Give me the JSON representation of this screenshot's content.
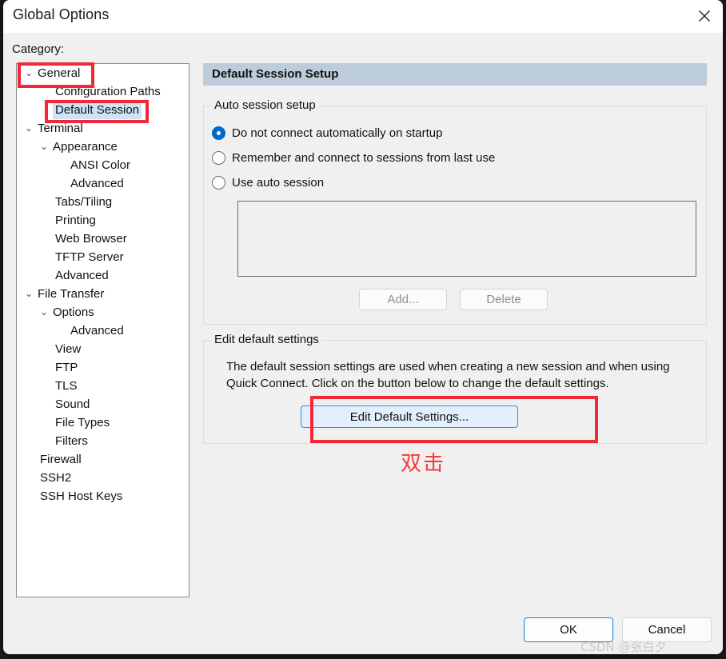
{
  "window": {
    "title": "Global Options",
    "close_icon": "close-icon"
  },
  "sidebar": {
    "label": "Category:",
    "items": [
      {
        "label": "General",
        "indent": 0,
        "chevron": "⌄",
        "selected": false
      },
      {
        "label": "Configuration Paths",
        "indent": 2,
        "chevron": "",
        "selected": false
      },
      {
        "label": "Default Session",
        "indent": 2,
        "chevron": "",
        "selected": true
      },
      {
        "label": "Terminal",
        "indent": 0,
        "chevron": "⌄",
        "selected": false
      },
      {
        "label": "Appearance",
        "indent": 1,
        "chevron": "⌄",
        "selected": false
      },
      {
        "label": "ANSI Color",
        "indent": 3,
        "chevron": "",
        "selected": false
      },
      {
        "label": "Advanced",
        "indent": 3,
        "chevron": "",
        "selected": false
      },
      {
        "label": "Tabs/Tiling",
        "indent": 2,
        "chevron": "",
        "selected": false
      },
      {
        "label": "Printing",
        "indent": 2,
        "chevron": "",
        "selected": false
      },
      {
        "label": "Web Browser",
        "indent": 2,
        "chevron": "",
        "selected": false
      },
      {
        "label": "TFTP Server",
        "indent": 2,
        "chevron": "",
        "selected": false
      },
      {
        "label": "Advanced",
        "indent": 2,
        "chevron": "",
        "selected": false
      },
      {
        "label": "File Transfer",
        "indent": 0,
        "chevron": "⌄",
        "selected": false
      },
      {
        "label": "Options",
        "indent": 1,
        "chevron": "⌄",
        "selected": false
      },
      {
        "label": "Advanced",
        "indent": 3,
        "chevron": "",
        "selected": false
      },
      {
        "label": "View",
        "indent": 2,
        "chevron": "",
        "selected": false
      },
      {
        "label": "FTP",
        "indent": 2,
        "chevron": "",
        "selected": false
      },
      {
        "label": "TLS",
        "indent": 2,
        "chevron": "",
        "selected": false
      },
      {
        "label": "Sound",
        "indent": 2,
        "chevron": "",
        "selected": false
      },
      {
        "label": "File Types",
        "indent": 2,
        "chevron": "",
        "selected": false
      },
      {
        "label": "Filters",
        "indent": 2,
        "chevron": "",
        "selected": false
      },
      {
        "label": "Firewall",
        "indent": 1,
        "chevron": "",
        "selected": false
      },
      {
        "label": "SSH2",
        "indent": 1,
        "chevron": "",
        "selected": false
      },
      {
        "label": "SSH Host Keys",
        "indent": 1,
        "chevron": "",
        "selected": false
      }
    ]
  },
  "panel": {
    "header": "Default Session Setup",
    "auto_session": {
      "title": "Auto session setup",
      "options": [
        {
          "label": "Do not connect automatically on startup",
          "checked": true
        },
        {
          "label": "Remember and connect to sessions from last use",
          "checked": false
        },
        {
          "label": "Use auto session",
          "checked": false
        }
      ],
      "list_value": "",
      "add_button": "Add...",
      "delete_button": "Delete"
    },
    "edit_defaults": {
      "title": "Edit default settings",
      "description": "The default session settings are used when creating a new session and when using Quick Connect.  Click on the button below to change the default settings.",
      "button": "Edit Default Settings..."
    }
  },
  "footer": {
    "ok": "OK",
    "cancel": "Cancel"
  },
  "annotations": {
    "callout_text": "双击",
    "watermark": "CSDN @张白夕"
  },
  "colors": {
    "accent": "#0068c8",
    "panel_header": "#bdccdb",
    "annotation_red": "#f32735",
    "selection_blue": "#cce4f7"
  }
}
